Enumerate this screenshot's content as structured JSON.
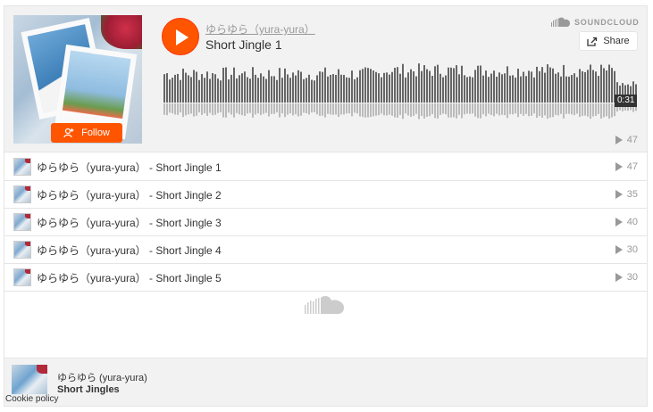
{
  "header": {
    "artist": "ゆらゆら（yura-yura）",
    "title": "Short Jingle 1",
    "follow_label": "Follow",
    "share_label": "Share",
    "brand": "SOUNDCLOUD",
    "time": "0:31",
    "play_count": "47"
  },
  "tracks": [
    {
      "name": "ゆらゆら（yura-yura） - Short Jingle 1",
      "plays": "47"
    },
    {
      "name": "ゆらゆら（yura-yura） - Short Jingle 2",
      "plays": "35"
    },
    {
      "name": "ゆらゆら（yura-yura） - Short Jingle 3",
      "plays": "40"
    },
    {
      "name": "ゆらゆら（yura-yura） - Short Jingle 4",
      "plays": "30"
    },
    {
      "name": "ゆらゆら（yura-yura） - Short Jingle 5",
      "plays": "30"
    }
  ],
  "footer": {
    "artist": "ゆらゆら (yura-yura)",
    "playlist_title": "Short Jingles"
  },
  "cookie_policy": "Cookie policy",
  "colors": {
    "accent": "#ff5500",
    "text_muted": "#999999",
    "waveform": "#666666"
  },
  "icons": {
    "play": "play-icon",
    "follow": "add-user-icon",
    "share": "share-icon",
    "brand": "soundcloud-icon",
    "count": "play-count-icon",
    "loader": "soundcloud-loader-icon"
  }
}
